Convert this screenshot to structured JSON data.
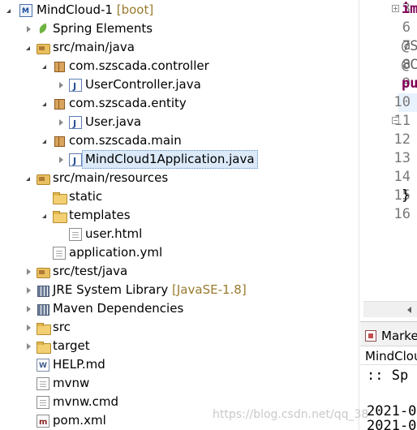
{
  "explorer": {
    "items": [
      {
        "label": "MindCloud-1",
        "decoration": "[boot]",
        "icon": "maven-project-icon"
      },
      {
        "label": "Spring Elements",
        "decoration": "",
        "icon": "spring-leaf-icon"
      },
      {
        "label": "src/main/java",
        "decoration": "",
        "icon": "source-folder-icon"
      },
      {
        "label": "com.szscada.controller",
        "decoration": "",
        "icon": "package-icon"
      },
      {
        "label": "UserController.java",
        "decoration": "",
        "icon": "java-file-icon"
      },
      {
        "label": "com.szscada.entity",
        "decoration": "",
        "icon": "package-icon"
      },
      {
        "label": "User.java",
        "decoration": "",
        "icon": "java-file-icon"
      },
      {
        "label": "com.szscada.main",
        "decoration": "",
        "icon": "package-icon"
      },
      {
        "label": "MindCloud1Application.java",
        "decoration": "",
        "icon": "java-file-icon"
      },
      {
        "label": "src/main/resources",
        "decoration": "",
        "icon": "source-folder-icon"
      },
      {
        "label": "static",
        "decoration": "",
        "icon": "folder-icon"
      },
      {
        "label": "templates",
        "decoration": "",
        "icon": "folder-open-icon"
      },
      {
        "label": "user.html",
        "decoration": "",
        "icon": "file-icon"
      },
      {
        "label": "application.yml",
        "decoration": "",
        "icon": "file-icon"
      },
      {
        "label": "src/test/java",
        "decoration": "",
        "icon": "source-folder-icon"
      },
      {
        "label": "JRE System Library",
        "decoration": "[JavaSE-1.8]",
        "icon": "library-icon"
      },
      {
        "label": "Maven Dependencies",
        "decoration": "",
        "icon": "library-icon"
      },
      {
        "label": "src",
        "decoration": "",
        "icon": "folder-icon"
      },
      {
        "label": "target",
        "decoration": "",
        "icon": "folder-icon"
      },
      {
        "label": "HELP.md",
        "decoration": "",
        "icon": "doc-file-icon"
      },
      {
        "label": "mvnw",
        "decoration": "",
        "icon": "file-icon"
      },
      {
        "label": "mvnw.cmd",
        "decoration": "",
        "icon": "file-icon"
      },
      {
        "label": "pom.xml",
        "decoration": "",
        "icon": "xml-file-icon"
      }
    ]
  },
  "editor": {
    "lines": [
      {
        "num": "3",
        "code": "im"
      },
      {
        "num": "6",
        "code": ""
      },
      {
        "num": "7",
        "code": "@S"
      },
      {
        "num": "8",
        "code": "@C"
      },
      {
        "num": "9",
        "code": "pu"
      },
      {
        "num": "10",
        "code": ""
      },
      {
        "num": "11",
        "code": ""
      },
      {
        "num": "12",
        "code": ""
      },
      {
        "num": "13",
        "code": ""
      },
      {
        "num": "14",
        "code": ""
      },
      {
        "num": "15",
        "code": "}"
      },
      {
        "num": "16",
        "code": ""
      }
    ],
    "fold_expand": "+",
    "fold_collapse": "−"
  },
  "console": {
    "tab_label": "Marke",
    "title": "MindClou",
    "lines": [
      ":: Sp",
      "",
      "2021-0",
      "2021-0"
    ]
  },
  "watermark": "https://blog.csdn.net/qq_38"
}
